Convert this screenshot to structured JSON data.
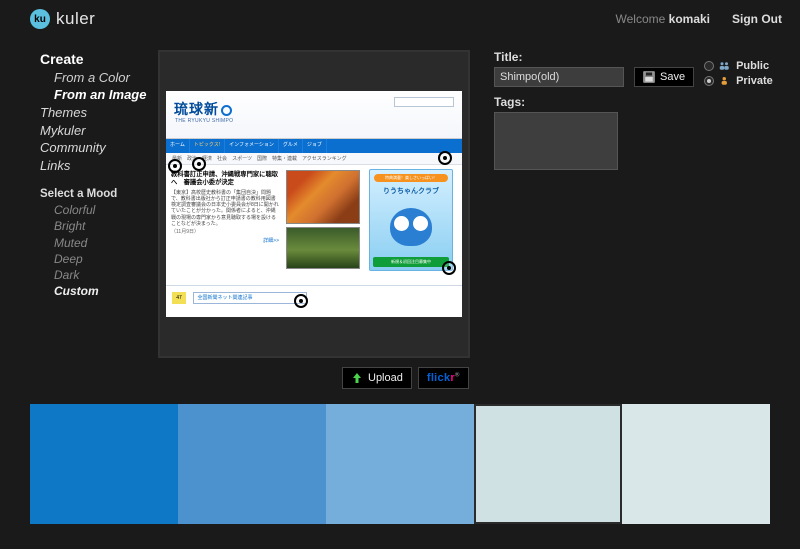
{
  "brand": {
    "logo_text": "ku",
    "name": "kuler"
  },
  "header": {
    "welcome_prefix": "Welcome ",
    "username": "komaki",
    "signout": "Sign Out"
  },
  "sidebar": {
    "create": "Create",
    "from_color": "From a Color",
    "from_image": "From an Image",
    "themes": "Themes",
    "mykuler": "Mykuler",
    "community": "Community",
    "links": "Links",
    "mood_label": "Select a Mood",
    "moods": [
      "Colorful",
      "Bright",
      "Muted",
      "Deep",
      "Dark",
      "Custom"
    ],
    "selected_mood": "Custom"
  },
  "screenshot": {
    "logo": "琉球新",
    "sublogo": "THE RYUKYU SHIMPO",
    "tabs": [
      "ホーム",
      "トピックス!",
      "インフォメーション",
      "グルメ",
      "ジョブ"
    ],
    "menu": [
      "最新",
      "政治",
      "経済",
      "社会",
      "スポーツ",
      "国際",
      "特集・連載",
      "アクセスランキング"
    ],
    "headline": "教科書訂正申請、沖縄戦専門家に聴取へ　審議会小委が決定",
    "body": "【東京】高校歴史教科書の「集団自決」問題で、教科書出版社から訂正申請書の教科用図書検定調査審議会の日本史小委員会が8日に開かれていたことが分かった。関係者によると、沖縄戦の現場の専門家から意見聴取する場を設けることなどが決まった。",
    "date": "（11月9日）",
    "more": "詳細>>",
    "promo_bar": "特典満載！楽しさいっぱい！",
    "promo_name": "りうちゃんクラブ",
    "promo_green": "新規＆初回注目募集中",
    "yellow": "47",
    "blink": "全国新聞ネット関連記事"
  },
  "form": {
    "title_label": "Title:",
    "title_value": "Shimpo(old)",
    "save_label": "Save",
    "tags_label": "Tags:",
    "tags_value": "",
    "public_label": "Public",
    "private_label": "Private",
    "visibility_selected": "private"
  },
  "actions": {
    "upload_label": "Upload",
    "flickr_label": "flickr"
  },
  "palette": {
    "swatches": [
      "#0e78c7",
      "#4b92cf",
      "#76aedb",
      "#cfe1e2",
      "#d9e7e8"
    ],
    "active_index": 3
  }
}
